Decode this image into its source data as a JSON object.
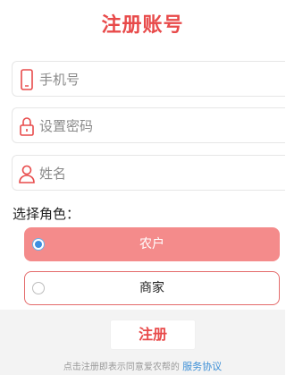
{
  "header": {
    "title": "注册账号"
  },
  "form": {
    "phone": {
      "placeholder": "手机号",
      "icon": "phone-icon"
    },
    "password": {
      "placeholder": "设置密码",
      "icon": "lock-icon"
    },
    "name": {
      "placeholder": "姓名",
      "icon": "user-icon"
    }
  },
  "roles": {
    "label": "选择角色：",
    "options": [
      {
        "label": "农户",
        "selected": true
      },
      {
        "label": "商家",
        "selected": false
      }
    ]
  },
  "submit_label": "注册",
  "agreement": {
    "prefix": "点击注册即表示同意爱农帮的",
    "link": "服务协议"
  },
  "colors": {
    "accent": "#e84a4a",
    "selected_role_bg": "#f48b8b",
    "link": "#3b8ed6"
  }
}
